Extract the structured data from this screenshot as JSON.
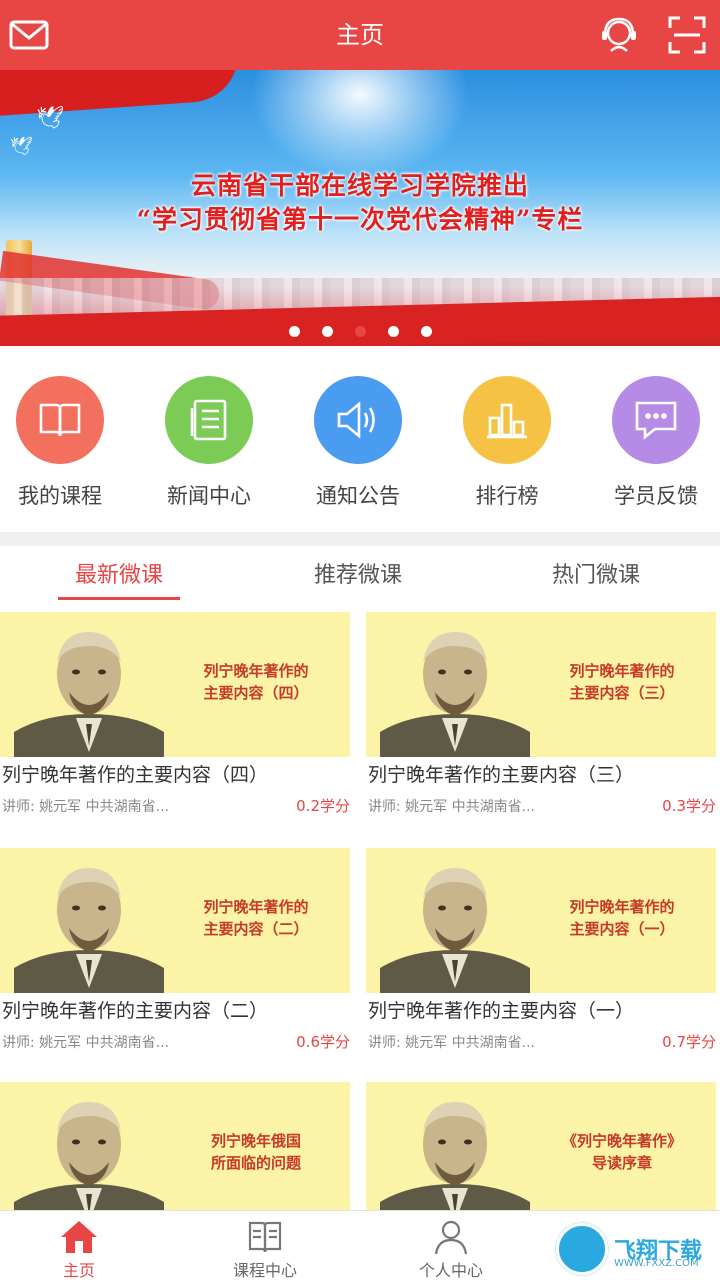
{
  "header": {
    "title": "主页"
  },
  "banner": {
    "line1": "云南省干部在线学习学院推出",
    "line2": "“学习贯彻省第十一次党代会精神”专栏",
    "active_dot": 3,
    "dot_count": 5
  },
  "shortcuts": [
    {
      "label": "我的课程",
      "icon": "book-icon",
      "color": "#f36f5e"
    },
    {
      "label": "新闻中心",
      "icon": "news-icon",
      "color": "#7ccb57"
    },
    {
      "label": "通知公告",
      "icon": "speaker-icon",
      "color": "#4a9cf0"
    },
    {
      "label": "排行榜",
      "icon": "bar-chart-icon",
      "color": "#f5c244"
    },
    {
      "label": "学员反馈",
      "icon": "chat-icon",
      "color": "#b58be6"
    }
  ],
  "tabs": [
    {
      "label": "最新微课",
      "active": true
    },
    {
      "label": "推荐微课",
      "active": false
    },
    {
      "label": "热门微课",
      "active": false
    }
  ],
  "courses": [
    {
      "thumb_line1": "列宁晚年著作的",
      "thumb_line2": "主要内容（四）",
      "title": "列宁晚年著作的主要内容（四）",
      "meta": "讲师:  姚元军 中共湖南省...",
      "credit": "0.2学分"
    },
    {
      "thumb_line1": "列宁晚年著作的",
      "thumb_line2": "主要内容（三）",
      "title": "列宁晚年著作的主要内容（三）",
      "meta": "讲师:  姚元军 中共湖南省...",
      "credit": "0.3学分"
    },
    {
      "thumb_line1": "列宁晚年著作的",
      "thumb_line2": "主要内容（二）",
      "title": "列宁晚年著作的主要内容（二）",
      "meta": "讲师:  姚元军 中共湖南省...",
      "credit": "0.6学分"
    },
    {
      "thumb_line1": "列宁晚年著作的",
      "thumb_line2": "主要内容（一）",
      "title": "列宁晚年著作的主要内容（一）",
      "meta": "讲师:  姚元军 中共湖南省...",
      "credit": "0.7学分"
    },
    {
      "thumb_line1": "列宁晚年俄国",
      "thumb_line2": "所面临的问题",
      "title": "",
      "meta": "",
      "credit": ""
    },
    {
      "thumb_line1": "《列宁晚年著作》",
      "thumb_line2": "导读序章",
      "title": "",
      "meta": "",
      "credit": ""
    }
  ],
  "bottom_nav": [
    {
      "label": "主页",
      "icon": "home-icon",
      "active": true
    },
    {
      "label": "课程中心",
      "icon": "open-book-icon",
      "active": false
    },
    {
      "label": "个人中心",
      "icon": "person-icon",
      "active": false
    }
  ],
  "watermark": {
    "text": "飞翔下载",
    "sub": "WWW.FXXZ.COM"
  },
  "colors": {
    "accent": "#e84545",
    "thumb_bg": "#fbf3a6"
  }
}
